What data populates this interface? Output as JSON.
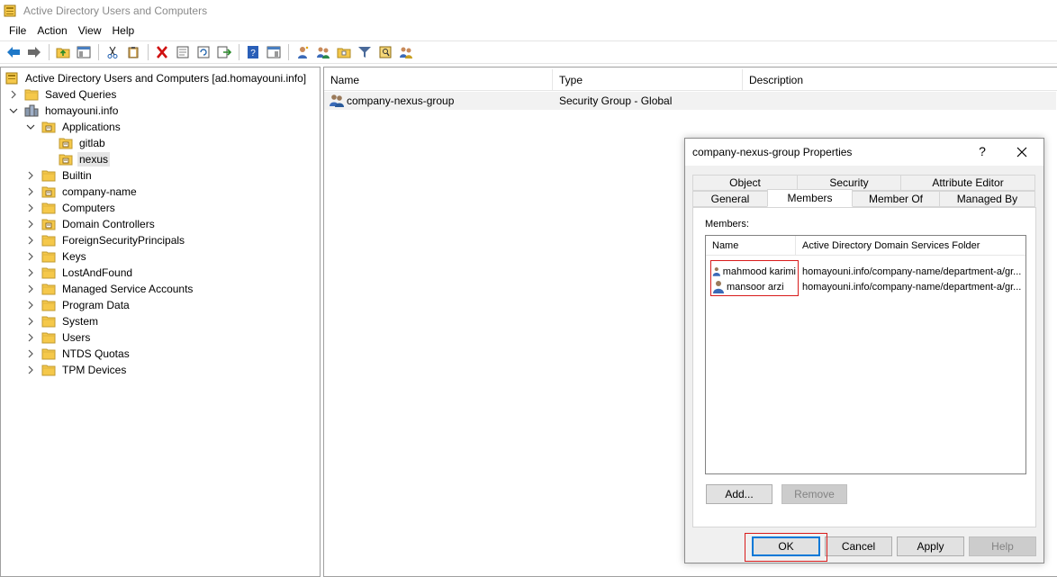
{
  "window": {
    "title": "Active Directory Users and Computers"
  },
  "menu": [
    "File",
    "Action",
    "View",
    "Help"
  ],
  "toolbar": {
    "icons": [
      "back-arrow-icon",
      "forward-arrow-icon",
      "up-folder-icon",
      "console-tree-icon",
      "cut-icon",
      "clipboard-icon",
      "delete-icon",
      "properties-icon",
      "refresh-icon",
      "export-list-icon",
      "help-icon",
      "show-hide-icon",
      "new-user-icon",
      "new-group-icon",
      "new-ou-icon",
      "filter-icon",
      "find-icon",
      "add-to-group-icon"
    ]
  },
  "tree": {
    "root": "Active Directory Users and Computers [ad.homayouni.info]",
    "items": [
      {
        "label": "Saved Queries"
      },
      {
        "label": "homayouni.info"
      },
      {
        "label": "Applications"
      },
      {
        "label": "gitlab"
      },
      {
        "label": "nexus"
      },
      {
        "label": "Builtin"
      },
      {
        "label": "company-name"
      },
      {
        "label": "Computers"
      },
      {
        "label": "Domain Controllers"
      },
      {
        "label": "ForeignSecurityPrincipals"
      },
      {
        "label": "Keys"
      },
      {
        "label": "LostAndFound"
      },
      {
        "label": "Managed Service Accounts"
      },
      {
        "label": "Program Data"
      },
      {
        "label": "System"
      },
      {
        "label": "Users"
      },
      {
        "label": "NTDS Quotas"
      },
      {
        "label": "TPM Devices"
      }
    ]
  },
  "list": {
    "columns": [
      "Name",
      "Type",
      "Description"
    ],
    "rows": [
      {
        "name": "company-nexus-group",
        "type": "Security Group - Global",
        "description": ""
      }
    ]
  },
  "dialog": {
    "title": "company-nexus-group Properties",
    "help": "?",
    "tabs_top": [
      "Object",
      "Security",
      "Attribute Editor"
    ],
    "tabs_bottom": [
      "General",
      "Members",
      "Member Of",
      "Managed By"
    ],
    "active_tab": "Members",
    "members_label": "Members:",
    "members_columns": [
      "Name",
      "Active Directory Domain Services Folder"
    ],
    "members": [
      {
        "name": "mahmood karimi",
        "folder": "homayouni.info/company-name/department-a/gr..."
      },
      {
        "name": "mansoor arzi",
        "folder": "homayouni.info/company-name/department-a/gr..."
      }
    ],
    "add_label": "Add...",
    "remove_label": "Remove",
    "ok_label": "OK",
    "cancel_label": "Cancel",
    "apply_label": "Apply",
    "help_label": "Help"
  },
  "colors": {
    "highlight": "#d81b1b",
    "folder": "#f5c84a",
    "selection": "#e5e5e5",
    "accent": "#0078d7"
  }
}
